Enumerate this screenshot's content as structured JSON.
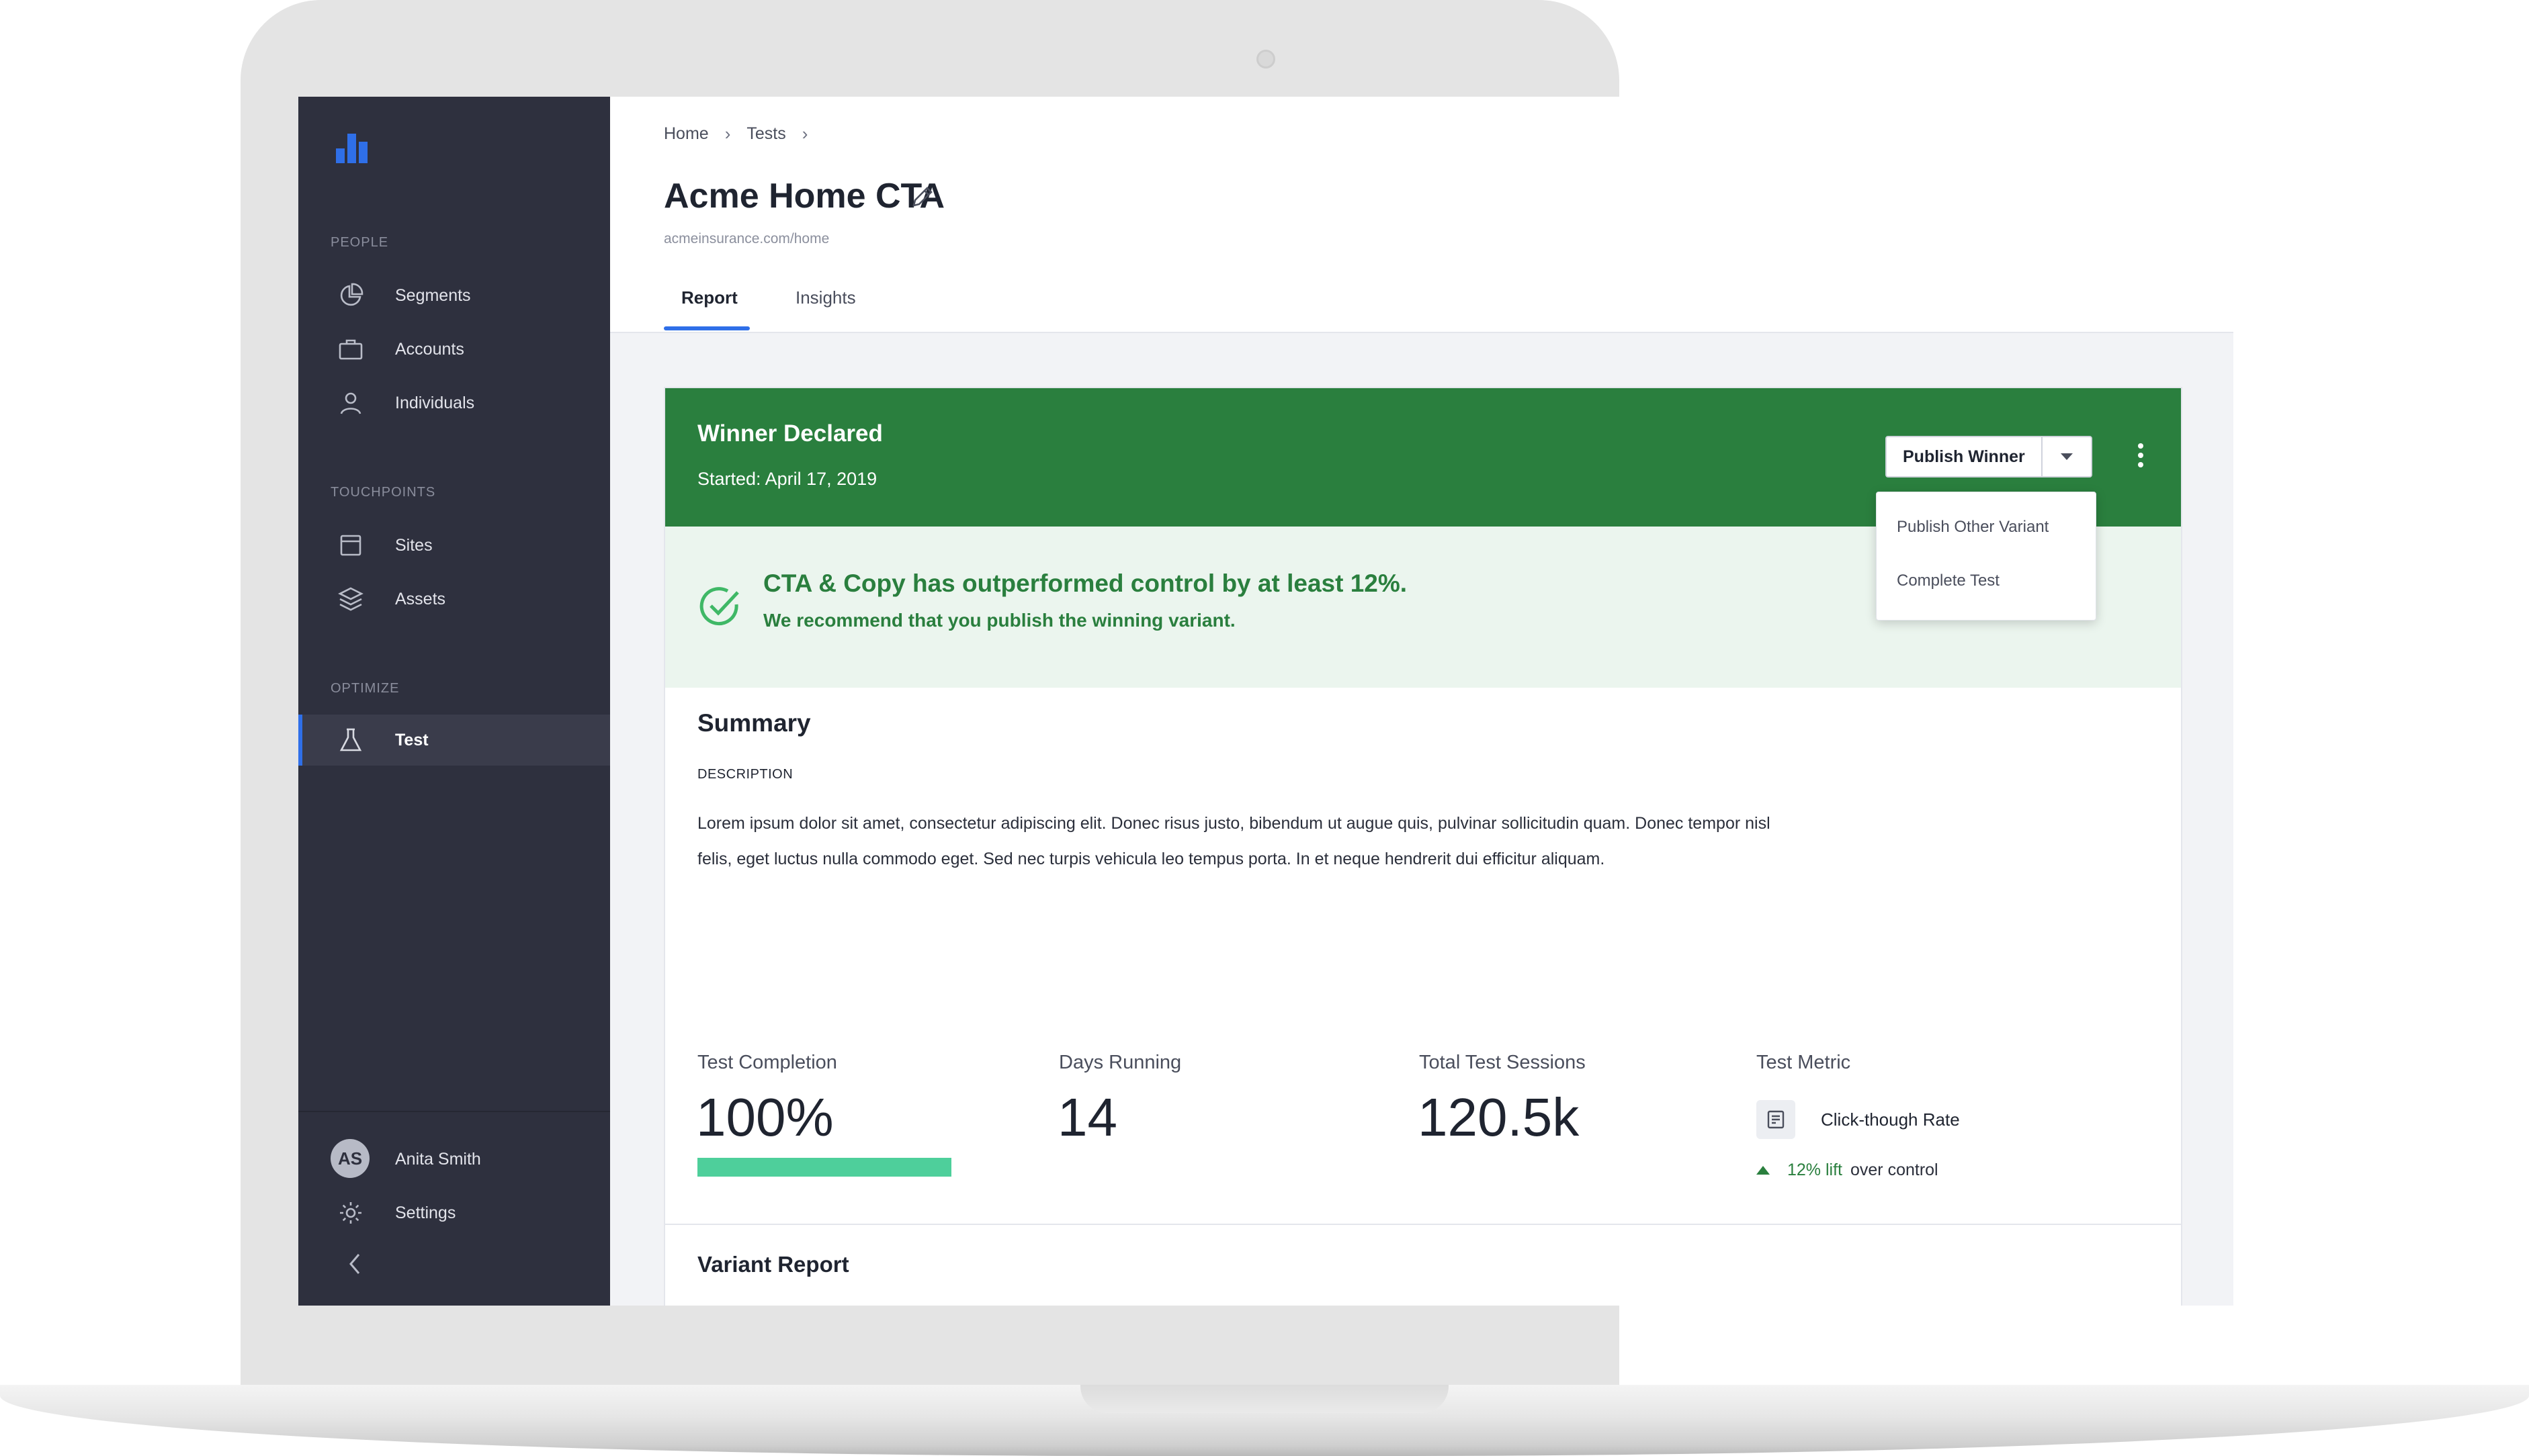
{
  "sidebar": {
    "sections": [
      {
        "title": "PEOPLE",
        "items": [
          {
            "label": "Segments",
            "icon": "pie-chart-icon"
          },
          {
            "label": "Accounts",
            "icon": "briefcase-icon"
          },
          {
            "label": "Individuals",
            "icon": "person-icon"
          }
        ]
      },
      {
        "title": "TOUCHPOINTS",
        "items": [
          {
            "label": "Sites",
            "icon": "browser-window-icon"
          },
          {
            "label": "Assets",
            "icon": "layers-icon"
          }
        ]
      },
      {
        "title": "OPTIMIZE",
        "items": [
          {
            "label": "Test",
            "icon": "flask-icon",
            "active": true
          }
        ]
      }
    ],
    "user": {
      "initials": "AS",
      "name": "Anita Smith"
    },
    "settings_label": "Settings"
  },
  "header": {
    "breadcrumb": [
      "Home",
      "Tests"
    ],
    "title": "Acme Home CTA",
    "url": "acmeinsurance.com/home",
    "tabs": [
      {
        "label": "Report",
        "active": true
      },
      {
        "label": "Insights",
        "active": false
      }
    ]
  },
  "winner": {
    "title": "Winner Declared",
    "started": "Started: April 17, 2019",
    "publish_label": "Publish Winner",
    "dropdown_options": [
      "Publish Other Variant",
      "Complete Test"
    ],
    "alert_title": "CTA & Copy has outperformed control by at least 12%.",
    "alert_sub": "We recommend that you publish the winning variant."
  },
  "summary": {
    "title": "Summary",
    "description_label": "DESCRIPTION",
    "description": "Lorem ipsum dolor sit amet, consectetur adipiscing elit. Donec risus justo, bibendum ut augue quis, pulvinar sollicitudin quam. Donec tempor nisl felis, eget luctus nulla commodo eget. Sed nec turpis vehicula leo tempus porta. In et neque hendrerit dui efficitur aliquam.",
    "stats": {
      "completion_label": "Test Completion",
      "completion_value": "100%",
      "completion_fraction": 1.0,
      "days_label": "Days Running",
      "days_value": "14",
      "sessions_label": "Total Test Sessions",
      "sessions_value": "120.5k",
      "metric_label": "Test Metric",
      "metric_name": "Click-though Rate",
      "lift_value": "12% lift",
      "lift_text": "over control"
    }
  },
  "variant_report": {
    "title": "Variant Report"
  },
  "colors": {
    "sidebar": "#2e303e",
    "accent": "#2f6fe8",
    "success": "#2a7f3e",
    "success_light": "#ebf5ee",
    "progress": "#4ecf9b"
  }
}
